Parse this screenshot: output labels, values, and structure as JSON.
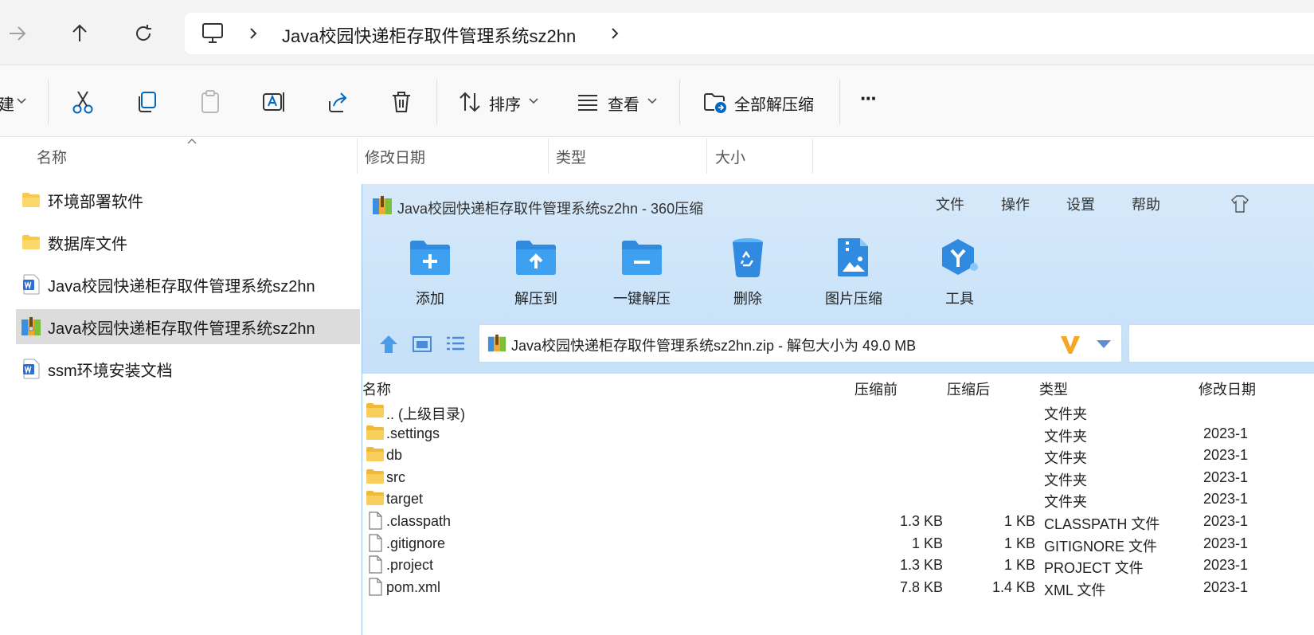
{
  "explorer": {
    "breadcrumb": "Java校园快递柜存取件管理系统sz2hn",
    "toolbar": {
      "new_label": "建",
      "sort_label": "排序",
      "view_label": "查看",
      "extract_all_label": "全部解压缩",
      "more_label": "···"
    },
    "columns": {
      "name": "名称",
      "modified": "修改日期",
      "type": "类型",
      "size": "大小"
    },
    "files": [
      {
        "name": "环境部署软件",
        "icon": "folder-icon"
      },
      {
        "name": "数据库文件",
        "icon": "folder-icon"
      },
      {
        "name": "Java校园快递柜存取件管理系统sz2hn",
        "icon": "word-doc-icon"
      },
      {
        "name": "Java校园快递柜存取件管理系统sz2hn",
        "icon": "zip-archive-icon",
        "selected": true
      },
      {
        "name": "ssm环境安装文档",
        "icon": "word-doc-icon"
      }
    ]
  },
  "zip_window": {
    "title": "Java校园快递柜存取件管理系统sz2hn - 360压缩",
    "menu": [
      "文件",
      "操作",
      "设置",
      "帮助"
    ],
    "tools": [
      {
        "label": "添加",
        "icon": "add-folder-icon"
      },
      {
        "label": "解压到",
        "icon": "extract-to-icon"
      },
      {
        "label": "一键解压",
        "icon": "one-click-extract-icon"
      },
      {
        "label": "删除",
        "icon": "recycle-bin-icon"
      },
      {
        "label": "图片压缩",
        "icon": "image-compress-icon"
      },
      {
        "label": "工具",
        "icon": "tools-icon"
      }
    ],
    "path": "Java校园快递柜存取件管理系统sz2hn.zip - 解包大小为 49.0 MB",
    "columns": {
      "name": "名称",
      "before": "压缩前",
      "after": "压缩后",
      "type": "类型",
      "modified": "修改日期"
    },
    "entries": [
      {
        "name": ".. (上级目录)",
        "before": "",
        "after": "",
        "type": "文件夹",
        "modified": "",
        "icon": "folder-icon"
      },
      {
        "name": ".settings",
        "before": "",
        "after": "",
        "type": "文件夹",
        "modified": "2023-1",
        "icon": "folder-icon"
      },
      {
        "name": "db",
        "before": "",
        "after": "",
        "type": "文件夹",
        "modified": "2023-1",
        "icon": "folder-icon"
      },
      {
        "name": "src",
        "before": "",
        "after": "",
        "type": "文件夹",
        "modified": "2023-1",
        "icon": "folder-icon"
      },
      {
        "name": "target",
        "before": "",
        "after": "",
        "type": "文件夹",
        "modified": "2023-1",
        "icon": "folder-icon"
      },
      {
        "name": ".classpath",
        "before": "1.3 KB",
        "after": "1 KB",
        "type": "CLASSPATH 文件",
        "modified": "2023-1",
        "icon": "file-icon"
      },
      {
        "name": ".gitignore",
        "before": "1 KB",
        "after": "1 KB",
        "type": "GITIGNORE 文件",
        "modified": "2023-1",
        "icon": "file-icon"
      },
      {
        "name": ".project",
        "before": "1.3 KB",
        "after": "1 KB",
        "type": "PROJECT 文件",
        "modified": "2023-1",
        "icon": "file-icon"
      },
      {
        "name": "pom.xml",
        "before": "7.8 KB",
        "after": "1.4 KB",
        "type": "XML 文件",
        "modified": "2023-1",
        "icon": "file-icon"
      }
    ]
  },
  "colors": {
    "accent": "#0067c0",
    "zip_bg": "#c9e2f8",
    "folder": "#f8c94a",
    "selection": "#dcdcdc"
  }
}
